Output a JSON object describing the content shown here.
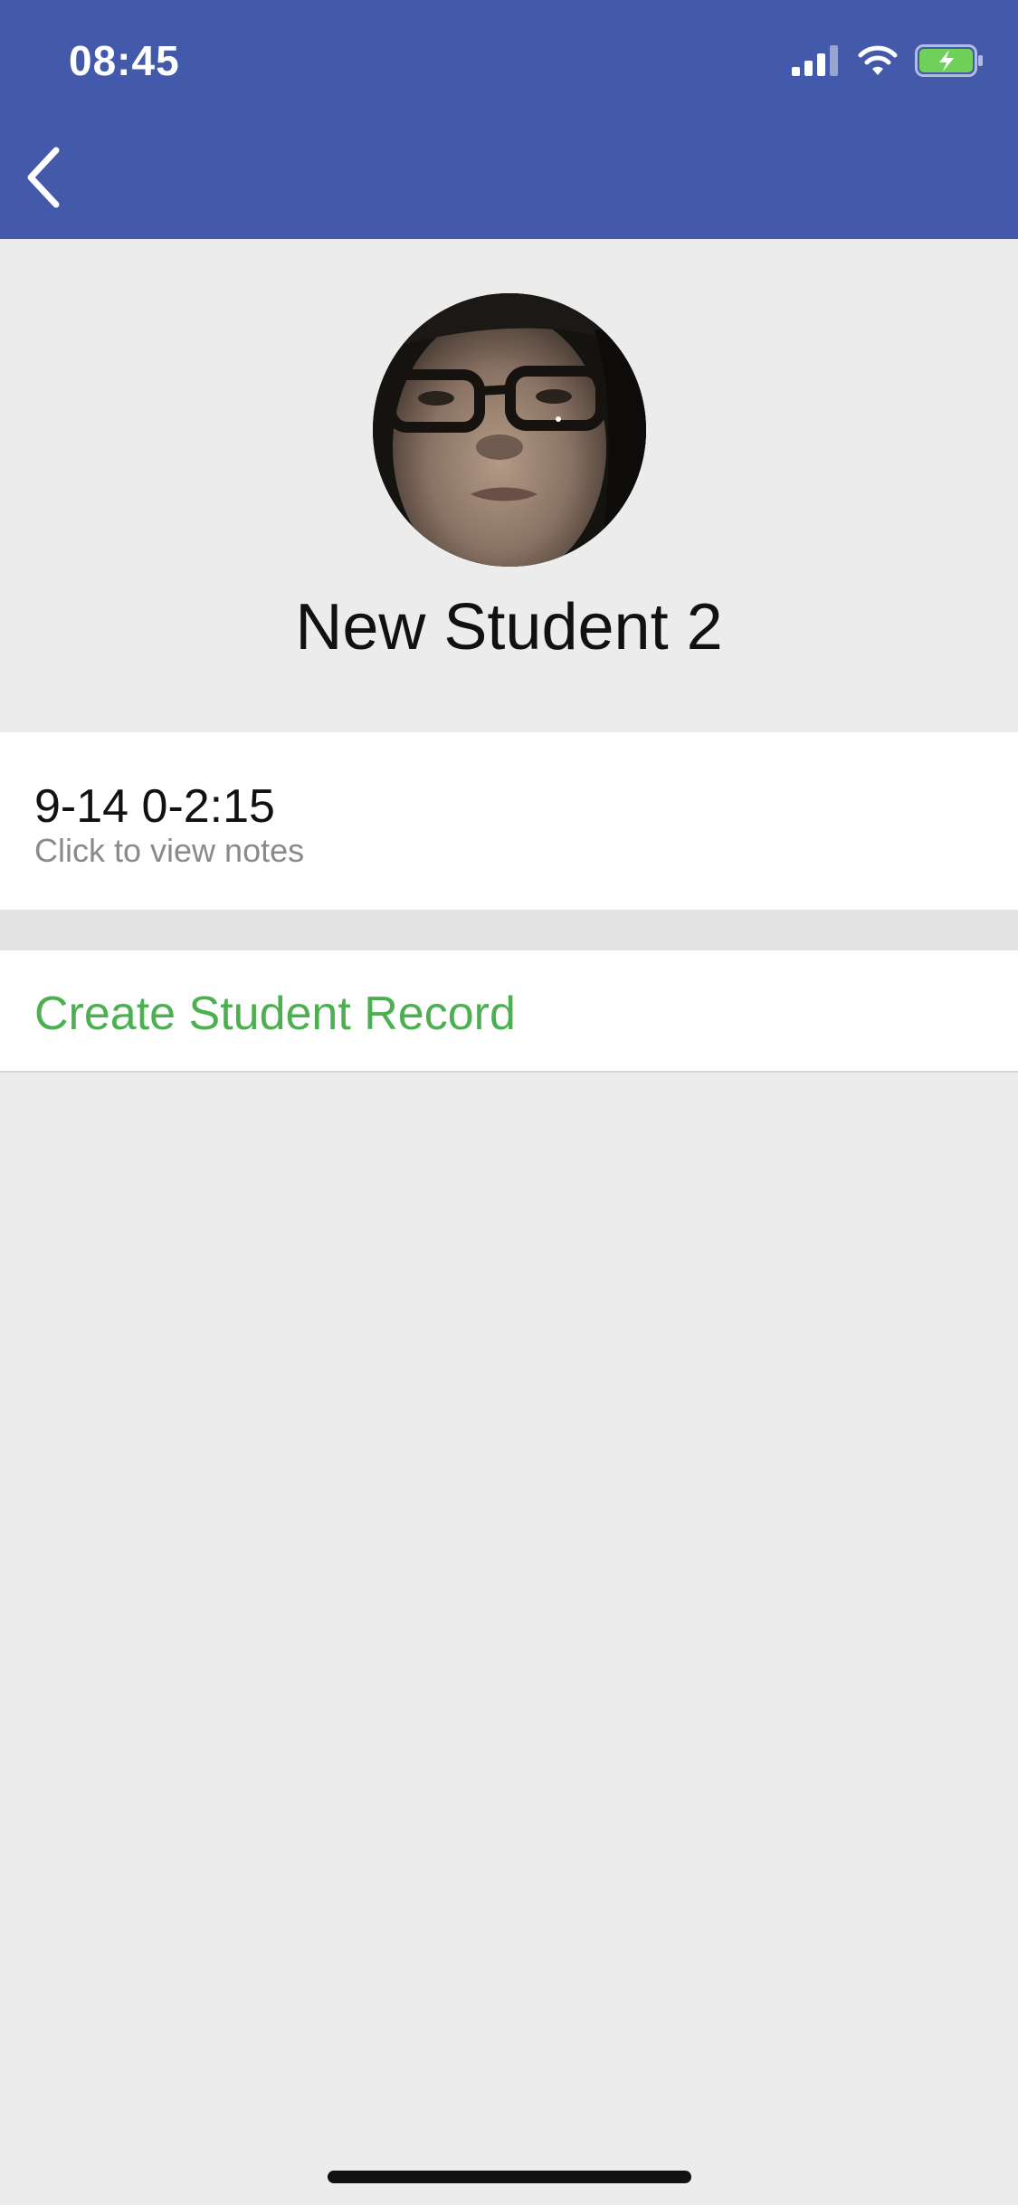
{
  "status_bar": {
    "time": "08:45",
    "icons": [
      "cellular-signal-icon",
      "wifi-icon",
      "battery-charging-icon"
    ]
  },
  "nav": {
    "back_icon": "chevron-left-icon",
    "background": "#4359aa"
  },
  "profile": {
    "name": "New Student 2",
    "avatar": "student-photo"
  },
  "records": [
    {
      "title": "9-14 0-2:15",
      "subtitle": "Click to view notes"
    }
  ],
  "actions": {
    "create_label": "Create Student Record",
    "create_color": "#4caf50"
  }
}
